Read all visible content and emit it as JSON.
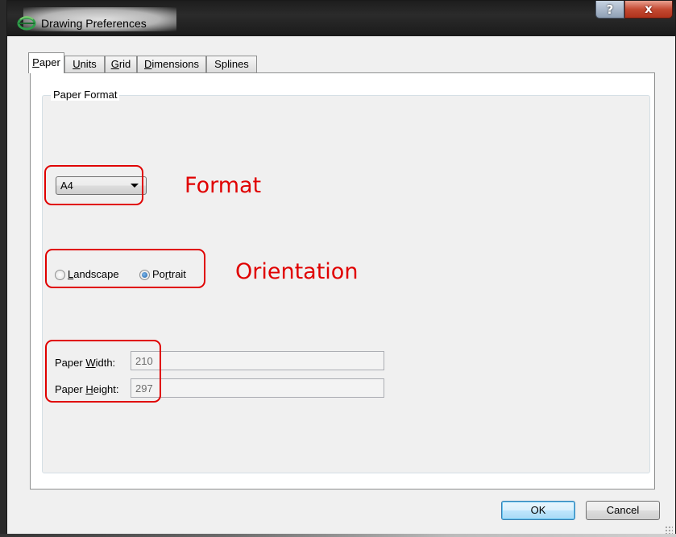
{
  "window": {
    "title": "Drawing Preferences",
    "help_label": "?",
    "close_label": "x"
  },
  "tabs": [
    {
      "label": "Paper",
      "underline": "P",
      "rest": "aper",
      "active": true
    },
    {
      "label": "Units",
      "underline": "U",
      "rest": "nits",
      "active": false
    },
    {
      "label": "Grid",
      "underline": "G",
      "rest": "rid",
      "active": false
    },
    {
      "label": "Dimensions",
      "underline": "D",
      "rest": "imensions",
      "active": false
    },
    {
      "label": "Splines",
      "underline": "",
      "rest": "Splines",
      "active": false
    }
  ],
  "paper": {
    "group_title": "Paper Format",
    "format_value": "A4",
    "orientation": {
      "landscape_label_u": "L",
      "landscape_label_rest": "andscape",
      "portrait_label_pre": "Po",
      "portrait_label_u": "r",
      "portrait_label_rest": "trait",
      "selected": "Portrait"
    },
    "width_label_pre": "Paper ",
    "width_label_u": "W",
    "width_label_rest": "idth:",
    "width_value": "210",
    "height_label_pre": "Paper ",
    "height_label_u": "H",
    "height_label_rest": "eight:",
    "height_value": "297"
  },
  "annotations": {
    "format": "Format",
    "orientation": "Orientation"
  },
  "buttons": {
    "ok": "OK",
    "cancel": "Cancel"
  },
  "colors": {
    "annotation": "#e00000",
    "default_button": "#a7d9f5",
    "close_button": "#c44a32"
  }
}
